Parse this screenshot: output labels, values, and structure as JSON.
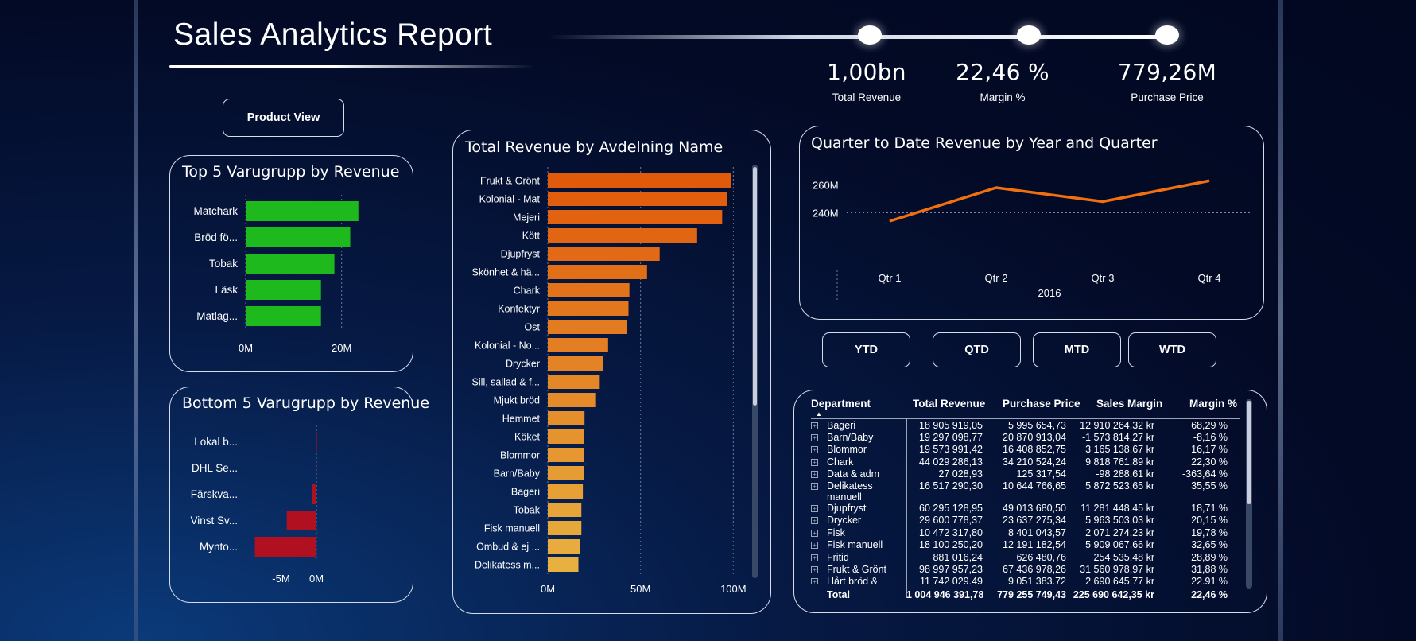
{
  "header": {
    "title": "Sales Analytics Report",
    "view_button": "Product View"
  },
  "kpis": [
    {
      "value": "1,00bn",
      "label": "Total Revenue"
    },
    {
      "value": "22,46 %",
      "label": "Margin %"
    },
    {
      "value": "779,26M",
      "label": "Purchase Price"
    }
  ],
  "period_buttons": [
    "YTD",
    "QTD",
    "MTD",
    "WTD"
  ],
  "colors": {
    "green_bar": "#1db91d",
    "red_bar": "#b01020",
    "orange_dark": "#e05a0c",
    "orange_light": "#e8b040",
    "line": "#f07010"
  },
  "chart_data": [
    {
      "type": "bar",
      "title": "Top 5 Varugrupp by Revenue",
      "categories": [
        "Matchark",
        "Bröd fö...",
        "Tobak",
        "Läsk",
        "Matlag..."
      ],
      "values": [
        23.5,
        21.8,
        18.5,
        15.7,
        15.7
      ],
      "ticks": [
        "0M",
        "20M"
      ],
      "xlim": [
        0,
        30
      ]
    },
    {
      "type": "bar",
      "title": "Bottom 5 Varugrupp by Revenue",
      "categories": [
        "Lokal b...",
        "DHL Se...",
        "Färskva...",
        "Vinst Sv...",
        "Mynto..."
      ],
      "values": [
        -0.05,
        -0.1,
        -0.6,
        -4.2,
        -8.7
      ],
      "ticks": [
        "-5M",
        "0M"
      ],
      "xlim": [
        -10,
        0
      ]
    },
    {
      "type": "bar",
      "title": "Total Revenue by Avdelning Name",
      "categories": [
        "Frukt & Grönt",
        "Kolonial - Mat",
        "Mejeri",
        "Kött",
        "Djupfryst",
        "Skönhet & hä...",
        "Chark",
        "Konfektyr",
        "Ost",
        "Kolonial - No...",
        "Drycker",
        "Sill, sallad & f...",
        "Mjukt bröd",
        "Hemmet",
        "Köket",
        "Blommor",
        "Barn/Baby",
        "Bageri",
        "Tobak",
        "Fisk manuell",
        "Ombud & ej ...",
        "Delikatess m..."
      ],
      "values": [
        99.0,
        96.5,
        94.0,
        80.5,
        60.3,
        53.5,
        44.0,
        43.5,
        42.5,
        32.5,
        29.6,
        28.0,
        26.0,
        19.8,
        19.6,
        19.6,
        19.3,
        18.9,
        18.1,
        18.1,
        17.2,
        16.5
      ],
      "ticks": [
        "0M",
        "50M",
        "100M"
      ],
      "xlim": [
        0,
        105
      ]
    },
    {
      "type": "line",
      "title": "Quarter to Date Revenue by Year and Quarter",
      "x": [
        "Qtr 1",
        "Qtr 2",
        "Qtr 3",
        "Qtr 4"
      ],
      "xgroup": "2016",
      "values": [
        234,
        258,
        248,
        263
      ],
      "yticks": [
        "260M",
        "240M"
      ],
      "ylim": [
        230,
        270
      ]
    }
  ],
  "table": {
    "headers": [
      "Department",
      "Total Revenue",
      "Purchase Price",
      "Sales Margin",
      "Margin %"
    ],
    "rows": [
      [
        "Bageri",
        "18 905 919,05",
        "5 995 654,73",
        "12 910 264,32 kr",
        "68,29 %"
      ],
      [
        "Barn/Baby",
        "19 297 098,77",
        "20 870 913,04",
        "-1 573 814,27 kr",
        "-8,16 %"
      ],
      [
        "Blommor",
        "19 573 991,42",
        "16 408 852,75",
        "3 165 138,67 kr",
        "16,17 %"
      ],
      [
        "Chark",
        "44 029 286,13",
        "34 210 524,24",
        "9 818 761,89 kr",
        "22,30 %"
      ],
      [
        "Data & adm",
        "27 028,93",
        "125 317,54",
        "-98 288,61 kr",
        "-363,64 %"
      ],
      [
        "Delikatess manuell",
        "16 517 290,30",
        "10 644 766,65",
        "5 872 523,65 kr",
        "35,55 %"
      ],
      [
        "Djupfryst",
        "60 295 128,95",
        "49 013 680,50",
        "11 281 448,45 kr",
        "18,71 %"
      ],
      [
        "Drycker",
        "29 600 778,37",
        "23 637 275,34",
        "5 963 503,03 kr",
        "20,15 %"
      ],
      [
        "Fisk",
        "10 472 317,80",
        "8 401 043,57",
        "2 071 274,23 kr",
        "19,78 %"
      ],
      [
        "Fisk manuell",
        "18 100 250,20",
        "12 191 182,54",
        "5 909 067,66 kr",
        "32,65 %"
      ],
      [
        "Fritid",
        "881 016,24",
        "626 480,76",
        "254 535,48 kr",
        "28,89 %"
      ],
      [
        "Frukt & Grönt",
        "98 997 957,23",
        "67 436 978,26",
        "31 560 978,97 kr",
        "31,88 %"
      ],
      [
        "Hårt bröd &",
        "11 742 029,49",
        "9 051 383,72",
        "2 690 645,77 kr",
        "22,91 %"
      ]
    ],
    "total": [
      "Total",
      "1 004 946 391,78",
      "779 255 749,43",
      "225 690 642,35 kr",
      "22,46 %"
    ]
  }
}
